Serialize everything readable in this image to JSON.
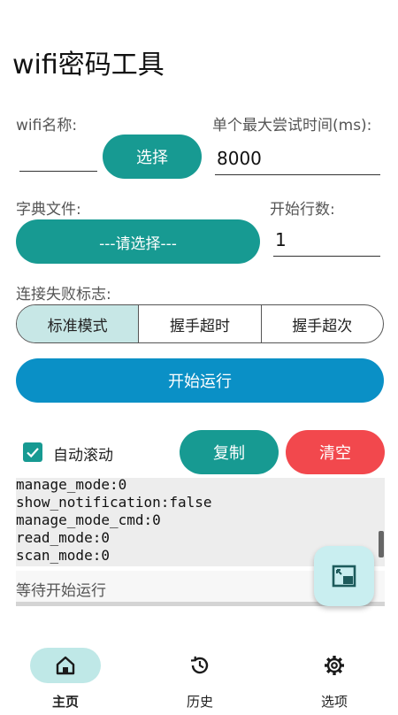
{
  "app": {
    "title": "wifi密码工具"
  },
  "form": {
    "wifi_name_label": "wifi名称:",
    "wifi_name_value": "",
    "select_button": "选择",
    "max_time_label": "单个最大尝试时间(ms):",
    "max_time_value": "8000",
    "dict_label": "字典文件:",
    "dict_button": "---请选择---",
    "start_line_label": "开始行数:",
    "start_line_value": "1",
    "fail_flag_label": "连接失败标志:"
  },
  "modes": [
    {
      "label": "标准模式",
      "active": true
    },
    {
      "label": "握手超时",
      "active": false
    },
    {
      "label": "握手超次",
      "active": false
    }
  ],
  "actions": {
    "run_button": "开始运行",
    "autoscroll_label": "自动滚动",
    "autoscroll_checked": true,
    "copy_button": "复制",
    "clear_button": "清空"
  },
  "log": {
    "lines": [
      "manage_mode:0",
      "show_notification:false",
      "manage_mode_cmd:0",
      "read_mode:0",
      "scan_mode:0"
    ],
    "status": "等待开始运行"
  },
  "bottom_nav": [
    {
      "label": "主页",
      "icon": "home-icon",
      "active": true
    },
    {
      "label": "历史",
      "icon": "history-icon",
      "active": false
    },
    {
      "label": "选项",
      "icon": "gear-icon",
      "active": false
    }
  ],
  "colors": {
    "teal": "#179a92",
    "blue": "#0a90c6",
    "red": "#f2484d",
    "segment_active": "#c7e7e6",
    "fab": "#c9eef0"
  }
}
